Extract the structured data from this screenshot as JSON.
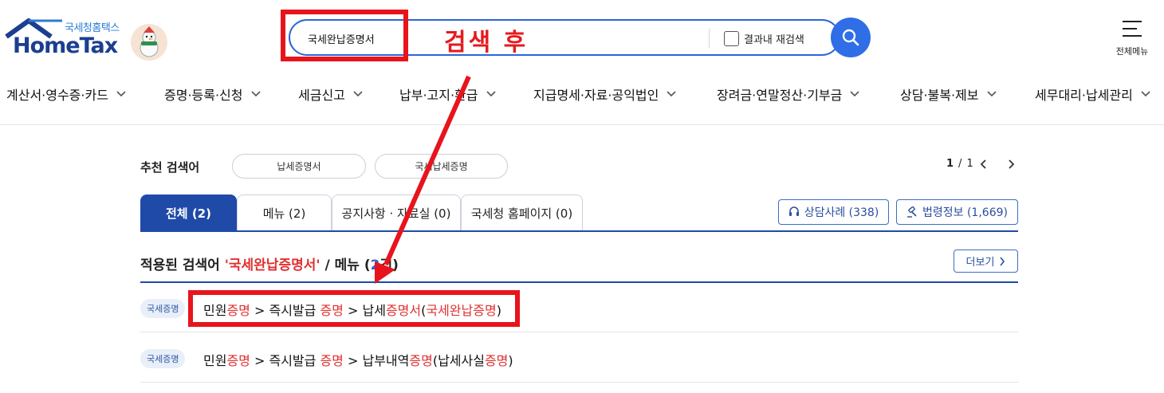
{
  "logo": {
    "sub": "국세청홈택스",
    "main": "HomeTax"
  },
  "search": {
    "value": "국세완납증명서",
    "research_label": "결과내 재검색"
  },
  "annotation": {
    "label": "검색 후"
  },
  "fullmenu": {
    "label": "전체메뉴"
  },
  "nav": {
    "items": [
      {
        "label": "계산서·영수증·카드"
      },
      {
        "label": "증명·등록·신청"
      },
      {
        "label": "세금신고"
      },
      {
        "label": "납부·고지·환급"
      },
      {
        "label": "지급명세·자료·공익법인"
      },
      {
        "label": "장려금·연말정산·기부금"
      },
      {
        "label": "상담·불복·제보"
      },
      {
        "label": "세무대리·납세관리"
      }
    ]
  },
  "recommended": {
    "title": "추천 검색어",
    "chips": [
      "납세증명서",
      "국세납세증명"
    ],
    "pager": {
      "current": "1",
      "separator": "/",
      "total": "1"
    }
  },
  "tabs": [
    {
      "label": "전체 (2)"
    },
    {
      "label": "메뉴 (2)"
    },
    {
      "label": "공지사항 · 자료실 (0)"
    },
    {
      "label": "국세청 홈페이지 (0)"
    }
  ],
  "side_buttons": {
    "consult": "상담사례 (338)",
    "law": "법령정보 (1,669)"
  },
  "result_head": {
    "prefix": "적용된 검색어 ",
    "term": "'국세완납증명서'",
    "middle": " / 메뉴 (",
    "count": "2",
    "suffix": "건)"
  },
  "more_label": "더보기",
  "results": [
    {
      "badge": "국세증명",
      "parts": [
        "민원",
        "증명",
        " > 즉시발급 ",
        "증명",
        " > 납세",
        "증명서",
        "(",
        "국세완납증명",
        ")"
      ]
    },
    {
      "badge": "국세증명",
      "parts": [
        "민원",
        "증명",
        " > 즉시발급 ",
        "증명",
        " > 납부내역",
        "증명",
        "(납세사실",
        "증명",
        ")"
      ]
    }
  ],
  "colors": {
    "accent": "#1f4aa8",
    "search_border": "#2b66d9",
    "highlight": "#e03131",
    "annotation": "#e8141c"
  }
}
